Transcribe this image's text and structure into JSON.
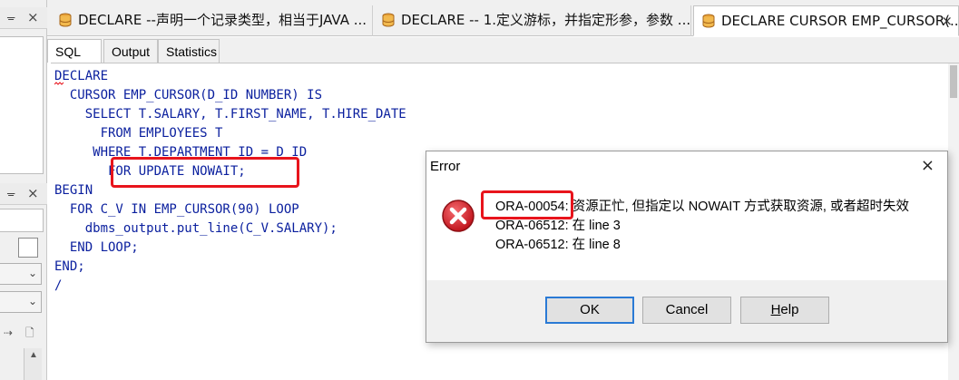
{
  "tabs": [
    {
      "title": "DECLARE --声明一个记录类型，相当于JAVA ...",
      "active": false
    },
    {
      "title": "DECLARE -- 1.定义游标，并指定形参，参数 ...",
      "active": false
    },
    {
      "title": "DECLARE CURSOR EMP_CURSOR(...",
      "active": true,
      "close": "×"
    }
  ],
  "left_panel": {
    "pin_glyph": "ᚚ",
    "close_glyph": "×"
  },
  "subtabs": [
    {
      "label": "SQL",
      "active": true
    },
    {
      "label": "Output",
      "active": false
    },
    {
      "label": "Statistics",
      "active": false
    }
  ],
  "code": {
    "lines": [
      "DECLARE",
      "  CURSOR EMP_CURSOR(D_ID NUMBER) IS",
      "    SELECT T.SALARY, T.FIRST_NAME, T.HIRE_DATE",
      "      FROM EMPLOYEES T",
      "     WHERE T.DEPARTMENT_ID = D_ID",
      "       FOR UPDATE NOWAIT;",
      "BEGIN",
      "  FOR C_V IN EMP_CURSOR(90) LOOP",
      "    dbms_output.put_line(C_V.SALARY);",
      "  END LOOP;",
      "END;",
      "/"
    ]
  },
  "dialog": {
    "title": "Error",
    "close": "×",
    "messages": [
      "ORA-00054: 资源正忙, 但指定以 NOWAIT 方式获取资源, 或者超时失效",
      "ORA-06512: 在 line 3",
      "ORA-06512: 在 line 8"
    ],
    "buttons": {
      "ok": "OK",
      "cancel": "Cancel",
      "help_first": "H",
      "help_rest": "elp"
    }
  },
  "colors": {
    "keyword": "#0a1f9e",
    "highlight": "#e8141c",
    "error_icon": "#d9232e",
    "default_button_border": "#2a7ad5"
  }
}
